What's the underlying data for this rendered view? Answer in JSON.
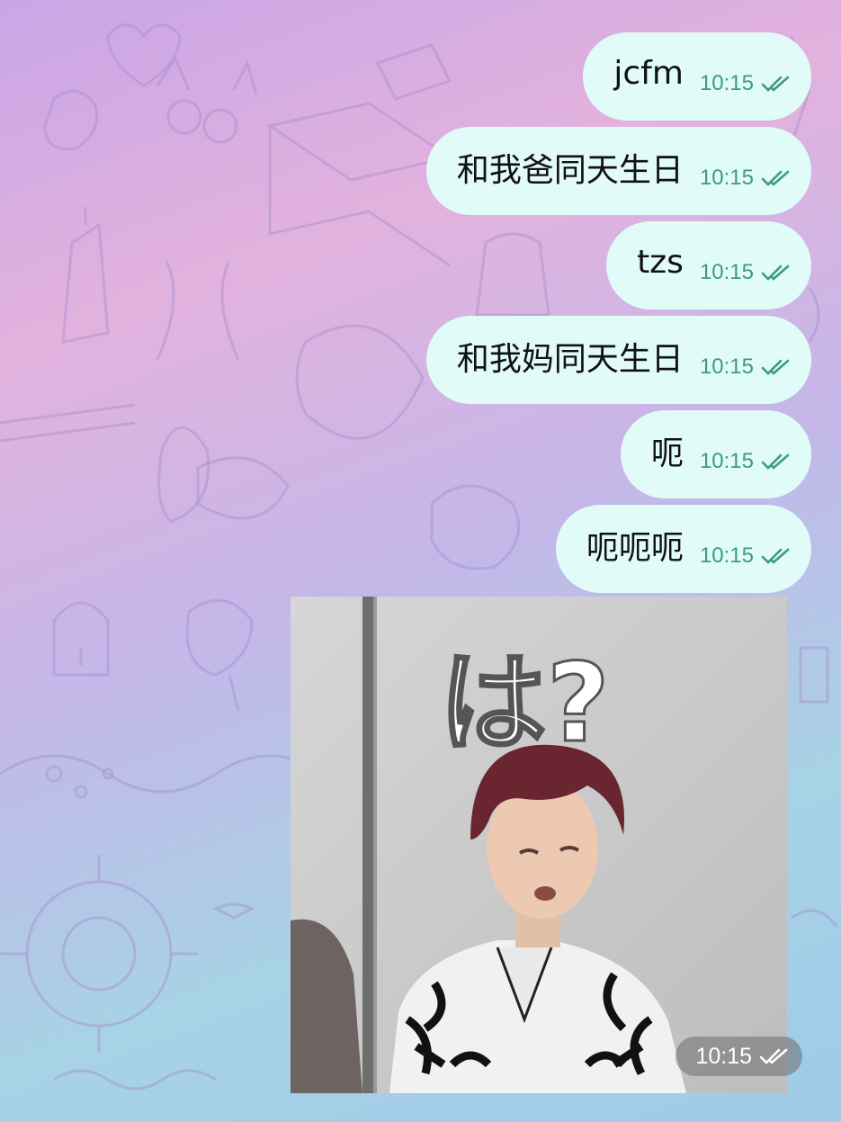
{
  "messages": [
    {
      "text": "jcfm",
      "time": "10:15"
    },
    {
      "text": "和我爸同天生日",
      "time": "10:15"
    },
    {
      "text": "tzs",
      "time": "10:15"
    },
    {
      "text": "和我妈同天生日",
      "time": "10:15"
    },
    {
      "text": "呃",
      "time": "10:15"
    },
    {
      "text": "呃呃呃",
      "time": "10:15"
    }
  ],
  "photo_message": {
    "caption_text": "は?",
    "time": "10:15"
  },
  "colors": {
    "bubble": "#e0fbf8",
    "time_outgoing": "#3f9a82",
    "doodle_stroke": "#a58fcf"
  },
  "icons": {
    "read_receipt": "double-check-icon"
  }
}
